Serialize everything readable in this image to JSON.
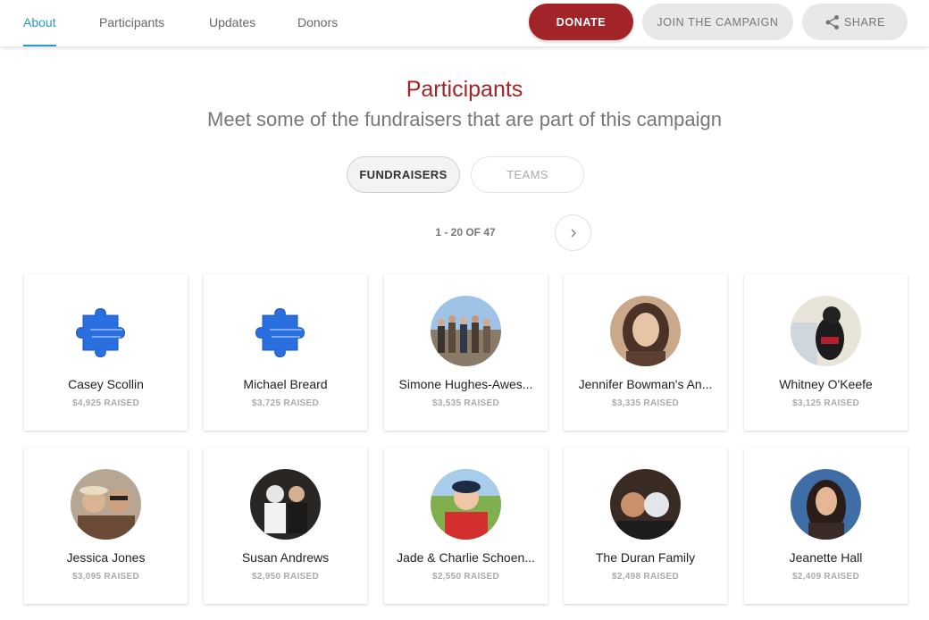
{
  "nav": {
    "tabs": [
      {
        "label": "About",
        "active": true
      },
      {
        "label": "Participants"
      },
      {
        "label": "Updates"
      },
      {
        "label": "Donors"
      }
    ],
    "donate_label": "DONATE",
    "join_label": "JOIN THE CAMPAIGN",
    "share_label": "SHARE"
  },
  "header": {
    "title": "Participants",
    "subtitle": "Meet some of the fundraisers that are part of this campaign"
  },
  "toggle": {
    "fundraisers_label": "FUNDRAISERS",
    "teams_label": "TEAMS"
  },
  "pager": {
    "range": "1 - 20 OF 47"
  },
  "colors": {
    "accent": "#a32428",
    "link": "#2a9bc4",
    "puzzle": "#2a6fe0"
  },
  "participants": [
    {
      "name": "Casey Scollin",
      "raised": "$4,925 RAISED",
      "avatar": "puzzle-logo"
    },
    {
      "name": "Michael Breard",
      "raised": "$3,725 RAISED",
      "avatar": "puzzle-logo"
    },
    {
      "name": "Simone Hughes-Awes...",
      "raised": "$3,535 RAISED",
      "avatar": "group-photo"
    },
    {
      "name": "Jennifer Bowman's An...",
      "raised": "$3,335 RAISED",
      "avatar": "portrait-photo"
    },
    {
      "name": "Whitney O'Keefe",
      "raised": "$3,125 RAISED",
      "avatar": "dog-photo"
    },
    {
      "name": "Jessica Jones",
      "raised": "$3,095 RAISED",
      "avatar": "selfie-photo"
    },
    {
      "name": "Susan Andrews",
      "raised": "$2,950 RAISED",
      "avatar": "costume-photo"
    },
    {
      "name": "Jade & Charlie Schoen...",
      "raised": "$2,550 RAISED",
      "avatar": "boy-photo"
    },
    {
      "name": "The Duran Family",
      "raised": "$2,498 RAISED",
      "avatar": "family-photo"
    },
    {
      "name": "Jeanette Hall",
      "raised": "$2,409 RAISED",
      "avatar": "woman-photo"
    }
  ]
}
